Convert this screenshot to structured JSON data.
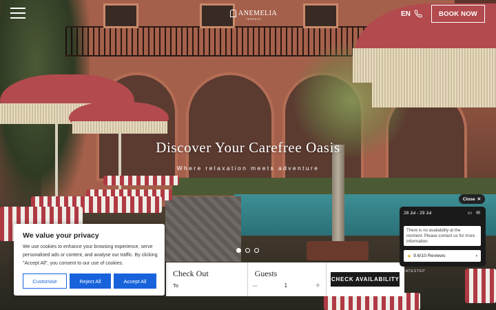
{
  "header": {
    "logo_text": "ANEMELIA",
    "logo_subtext": "TERRACE",
    "language": "EN",
    "book_now_label": "BOOK NOW"
  },
  "hero": {
    "title": "Discover Your Carefree Oasis",
    "subtitle": "Where relaxation meets adventure",
    "slides_count": 3,
    "active_slide": 1
  },
  "booking_bar": {
    "check_out_label": "Check Out",
    "check_out_value": "To",
    "guests_label": "Guests",
    "guests_minus": "–",
    "guests_value": "1",
    "guests_plus": "+",
    "check_availability_label": "CHECK AVAILABILITY"
  },
  "cookie_banner": {
    "title": "We value your privacy",
    "text": "We use cookies to enhance your browsing experience, serve personalised ads or content, and analyse our traffic. By clicking \"Accept All\", you consent to our use of cookies.",
    "customise_label": "Customise",
    "reject_label": "Reject All",
    "accept_label": "Accept All",
    "accent_color": "#1863dc"
  },
  "availability_widget": {
    "close_label": "Close",
    "dates": "28 Jul - 29 Jul",
    "message": "There is no availability at the moment. Please contact us for more information.",
    "rating": "9.6/10 Reviews",
    "branding": "RATESTEP"
  }
}
